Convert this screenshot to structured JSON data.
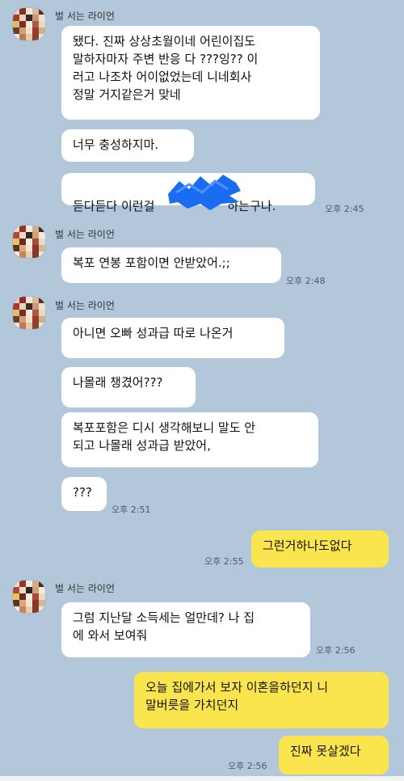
{
  "sender_name": "벌 서는 라이언",
  "messages": {
    "m1": "됐다. 진짜 상상초월이네 어린이집도\n말하자마자 주변 반응 다 ???잉?? 이\n러고  나조차 어이없었는데 니네회사\n정말 거지같은거 맞네",
    "m2": "너무 충성하지마.",
    "m3a": "듣다듣다 이런걸",
    "m3b": "하는구나.",
    "m4": "복포 연봉 포함이면 안받았어.;;",
    "m5": "아니면 오빠 성과급 따로 나온거",
    "m6": "나몰래 챙겼어???",
    "m7": "복포포함은 디시 생각해보니 말도 안\n되고 나몰래 성과급 받았어,",
    "m8": "???",
    "m9": "그런거하나도없다",
    "m10": "그럼 지난달 소득세는 얼만데? 나 집\n에 와서 보여줘",
    "m11": "오늘 집에가서 보자 이혼을하던지 니\n말버릇을 가치던지",
    "m12": "진짜 못살겠다"
  },
  "times": {
    "t1": "오후 2:45",
    "t2": "오후 2:48",
    "t3": "오후 2:51",
    "t4": "오후 2:55",
    "t5": "오후 2:56",
    "t6": "오후 2:56"
  },
  "colors": {
    "background": "#b2c7da",
    "incoming_bubble": "#ffffff",
    "outgoing_bubble": "#fbe54f",
    "redaction": "#1a6cf0"
  },
  "avatar_icon": "pixelated-avatar-icon",
  "redaction_icon": "blue-scribble-redaction"
}
